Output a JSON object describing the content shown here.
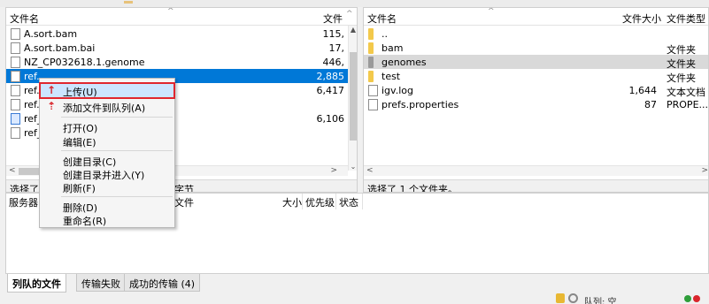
{
  "left_pane": {
    "header": {
      "name": "文件名",
      "size": "文件"
    },
    "rows": [
      {
        "name": "A.sort.bam",
        "size": "115,",
        "icon": "file-icon"
      },
      {
        "name": "A.sort.bam.bai",
        "size": "17,",
        "icon": "file-icon"
      },
      {
        "name": "NZ_CP032618.1.genome",
        "size": "446,",
        "icon": "file-icon"
      },
      {
        "name": "ref.",
        "size": "2,885",
        "icon": "file-icon",
        "selected": true
      },
      {
        "name": "ref.",
        "size": "6,417",
        "icon": "file-icon"
      },
      {
        "name": "ref.",
        "size": "",
        "icon": "file-icon"
      },
      {
        "name": "ref_",
        "size": "6,106",
        "icon": "special-file-icon"
      },
      {
        "name": "ref_",
        "size": "",
        "icon": "file-icon"
      }
    ],
    "status": "选择了",
    "status_tail": "字节"
  },
  "right_pane": {
    "header": {
      "name": "文件名",
      "size": "文件大小",
      "type": "文件类型"
    },
    "rows": [
      {
        "name": "..",
        "size": "",
        "type": "",
        "icon": "folder-icon"
      },
      {
        "name": "bam",
        "size": "",
        "type": "文件夹",
        "icon": "folder-icon"
      },
      {
        "name": "genomes",
        "size": "",
        "type": "文件夹",
        "icon": "folder-icon-gray",
        "highlight": true
      },
      {
        "name": "test",
        "size": "",
        "type": "文件夹",
        "icon": "folder-icon"
      },
      {
        "name": "igv.log",
        "size": "1,644",
        "type": "文本文档",
        "icon": "file-icon"
      },
      {
        "name": "prefs.properties",
        "size": "87",
        "type": "PROPE...",
        "icon": "file-icon"
      }
    ],
    "status": "选择了 1 个文件夹。"
  },
  "queue": {
    "headers": {
      "server": "服务器",
      "file": "文件",
      "size": "大小",
      "priority": "优先级",
      "status": "状态"
    }
  },
  "tabs": [
    {
      "label": "列队的文件",
      "active": true
    },
    {
      "label": "传输失败",
      "active": false
    },
    {
      "label": "成功的传输 (4)",
      "active": false
    }
  ],
  "bottom": {
    "queue_label": "队列: 空",
    "lock_icon": "lock-icon",
    "indicator_colors": [
      "#2e9e3a",
      "#d9262c"
    ]
  },
  "context_menu": {
    "items": [
      {
        "label": "上传(U)",
        "icon": "upload-icon",
        "highlight": true
      },
      {
        "label": "添加文件到队列(A)",
        "icon": "add-to-queue-icon"
      },
      {
        "label": "打开(O)",
        "icon": ""
      },
      {
        "label": "编辑(E)",
        "icon": ""
      },
      {
        "label": "创建目录(C)",
        "icon": ""
      },
      {
        "label": "创建目录并进入(Y)",
        "icon": ""
      },
      {
        "label": "刷新(F)",
        "icon": ""
      },
      {
        "label": "删除(D)",
        "icon": ""
      },
      {
        "label": "重命名(R)",
        "icon": ""
      }
    ]
  },
  "colors": {
    "selection": "#0078d7",
    "highlight_box": "#e0262e",
    "folder": "#f3c94b"
  }
}
